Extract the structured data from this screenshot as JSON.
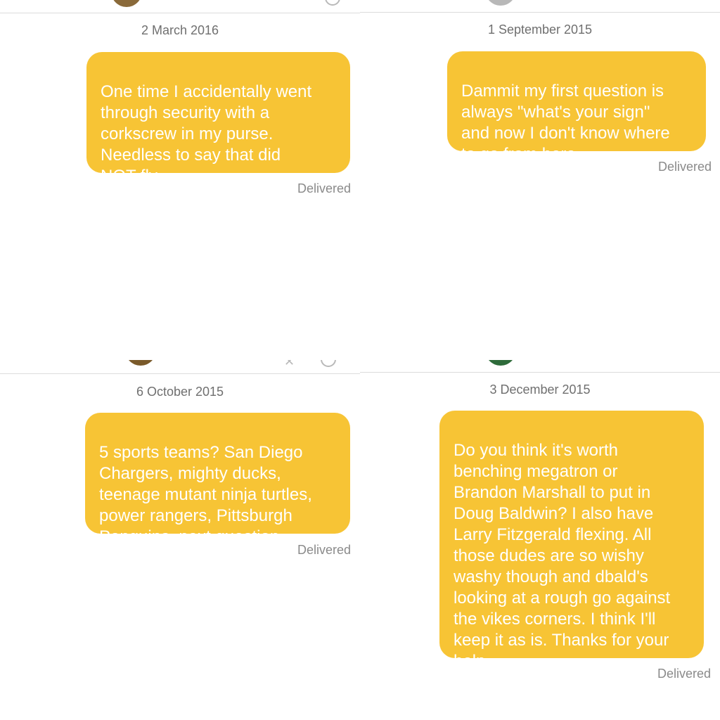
{
  "colors": {
    "bubble": "#f7c435",
    "bubble_text": "#ffffff",
    "date_text": "#6f6f6f",
    "status_text": "#8a8a8a",
    "divider": "#dcdcdc"
  },
  "panels": [
    {
      "date": "2 March 2016",
      "message": "One time I accidentally went\nthrough security with a\ncorkscrew in my purse.\nNeedless to say that did\nNOT fly",
      "status": "Delivered",
      "avatar_color": "#8a6a3a",
      "avatar_icon": "avatar-icon"
    },
    {
      "date": "1 September 2015",
      "message": "Dammit my first question is\nalways \"what's your sign\"\nand now I don't know where\nto go from here",
      "status": "Delivered",
      "avatar_color": "#b8b8b8",
      "avatar_icon": "avatar-icon"
    },
    {
      "date": "6 October 2015",
      "message": "5 sports teams? San Diego\nChargers, mighty ducks,\nteenage mutant ninja turtles,\npower rangers, Pittsburgh\nPenguins, next question.",
      "status": "Delivered",
      "avatar_color": "#7a5a2a",
      "avatar_icon": "avatar-icon"
    },
    {
      "date": "3 December 2015",
      "message": "Do you think it's worth\nbenching megatron or\nBrandon Marshall to put in\nDoug Baldwin? I also have\nLarry Fitzgerald flexing. All\nthose dudes are so wishy\nwashy though and dbald's\nlooking at a rough go against\nthe vikes corners. I think I'll\nkeep it as is. Thanks for your\nhelp",
      "status": "Delivered",
      "avatar_color": "#2e6b3a",
      "avatar_icon": "avatar-icon"
    }
  ]
}
